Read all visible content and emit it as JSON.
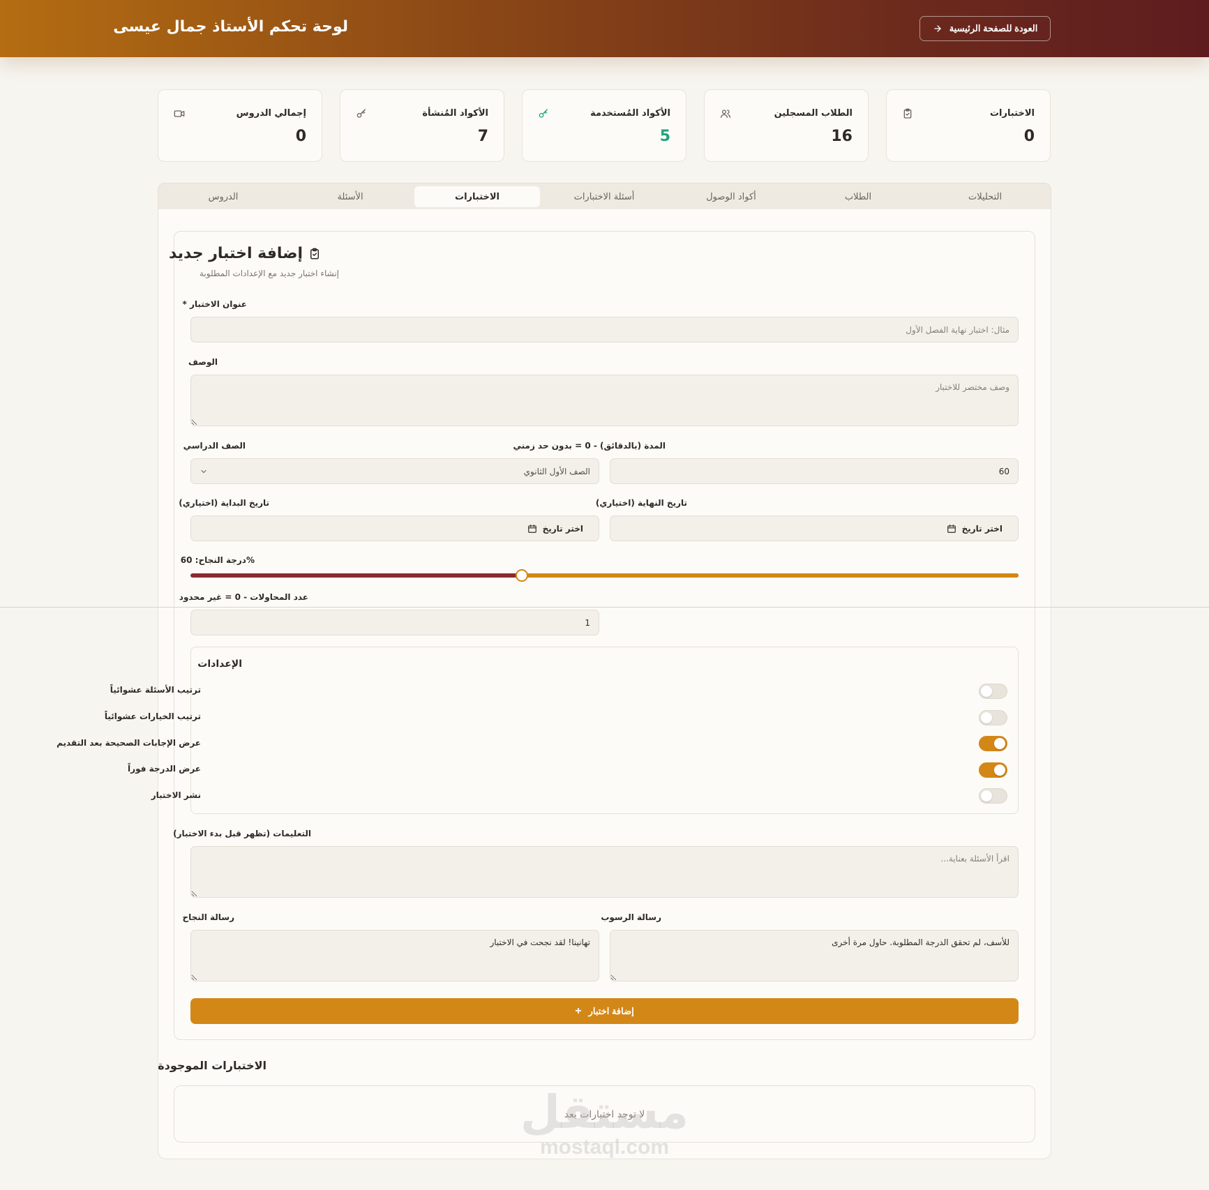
{
  "header": {
    "title": "لوحة تحكم الأستاذ جمال عيسى",
    "back_label": "العودة للصفحة الرئيسية"
  },
  "stats": [
    {
      "label": "الاختبارات",
      "value": "0",
      "icon": "clipboard-check-icon"
    },
    {
      "label": "الطلاب المسجلين",
      "value": "16",
      "icon": "users-icon"
    },
    {
      "label": "الأكواد المُستخدمة",
      "value": "5",
      "icon": "key-icon",
      "accent": "#21a47c"
    },
    {
      "label": "الأكواد المُنشأة",
      "value": "7",
      "icon": "key-icon"
    },
    {
      "label": "إجمالي الدروس",
      "value": "0",
      "icon": "video-icon"
    }
  ],
  "tabs": [
    {
      "label": "التحليلات"
    },
    {
      "label": "الطلاب"
    },
    {
      "label": "أكواد الوصول"
    },
    {
      "label": "أسئلة الاختبارات"
    },
    {
      "label": "الاختبارات",
      "active": true
    },
    {
      "label": "الأسئلة"
    },
    {
      "label": "الدروس"
    }
  ],
  "form": {
    "title": "إضافة اختبار جديد",
    "subtitle": "إنشاء اختبار جديد مع الإعدادات المطلوبة",
    "exam_title": {
      "label": "عنوان الاختبار *",
      "placeholder": "مثال: اختبار نهاية الفصل الأول"
    },
    "description": {
      "label": "الوصف",
      "placeholder": "وصف مختصر للاختبار"
    },
    "grade": {
      "label": "الصف الدراسي",
      "value": "الصف الأول الثانوي"
    },
    "duration": {
      "label": "المدة (بالدقائق) - 0 = بدون حد زمني",
      "value": "60"
    },
    "start_date": {
      "label": "تاريخ البداية (اختياري)",
      "value": "اختر تاريخ"
    },
    "end_date": {
      "label": "تاريخ النهاية (اختياري)",
      "value": "اختر تاريخ"
    },
    "pass_score": {
      "label": "درجة النجاح: 60%",
      "value": 60,
      "min": 0,
      "max": 100
    },
    "attempts": {
      "label": "عدد المحاولات - 0 = غير محدود",
      "value": "1"
    },
    "settings": {
      "title": "الإعدادات",
      "items": [
        {
          "label": "ترتيب الأسئلة عشوائياً",
          "on": false
        },
        {
          "label": "ترتيب الخيارات عشوائياً",
          "on": false
        },
        {
          "label": "عرض الإجابات الصحيحة بعد التقديم",
          "on": true
        },
        {
          "label": "عرض الدرجة فوراً",
          "on": true
        },
        {
          "label": "نشر الاختبار",
          "on": false
        }
      ]
    },
    "instructions": {
      "label": "التعليمات (تظهر قبل بدء الاختبار)",
      "placeholder": "اقرأ الأسئلة بعناية..."
    },
    "fail_message": {
      "label": "رسالة الرسوب",
      "value": "للأسف، لم تحقق الدرجة المطلوبة. حاول مرة أخرى"
    },
    "success_message": {
      "label": "رسالة النجاح",
      "value": "تهانينا! لقد نجحت في الاختبار"
    },
    "submit_label": "إضافة اختبار"
  },
  "existing": {
    "title": "الاختبارات الموجودة",
    "empty_text": "لا توجد اختبارات بعد"
  },
  "watermark": {
    "ar": "مستقل",
    "en": "mostaql.com"
  },
  "colors": {
    "accent": "#d38717",
    "header_start": "#b46d12",
    "header_end": "#5e1c1e",
    "success": "#21a47c",
    "slider_rest": "#8b2a2e"
  }
}
